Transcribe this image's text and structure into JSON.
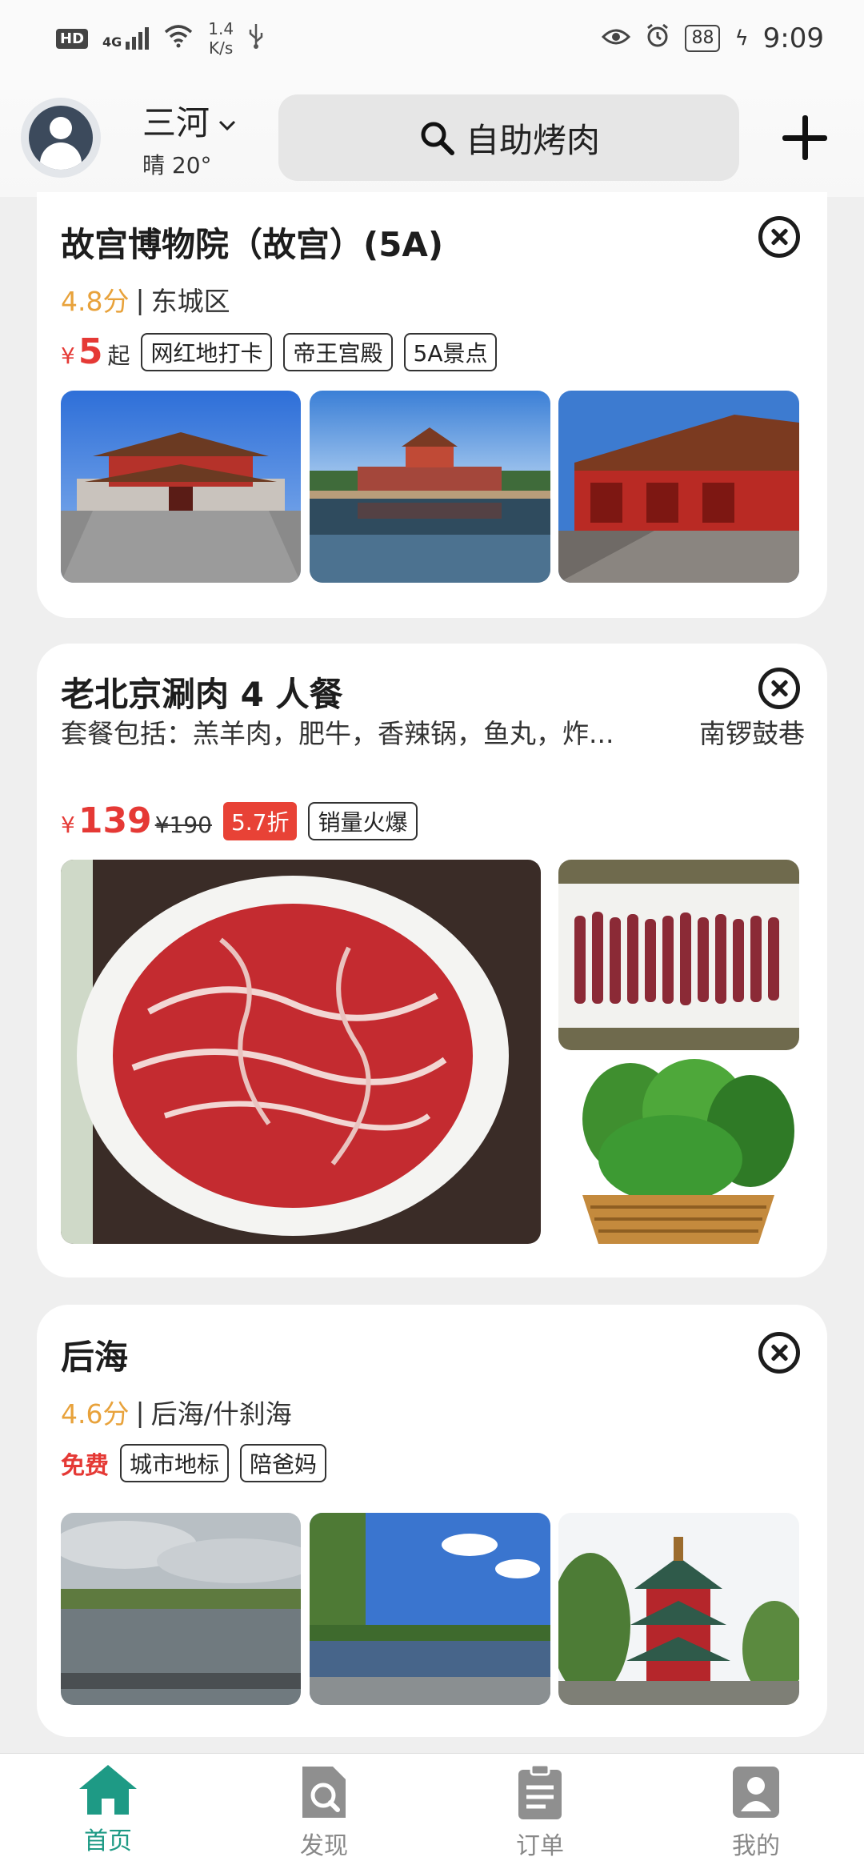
{
  "status_bar": {
    "hd": "HD",
    "network": "4G",
    "net_speed_value": "1.4",
    "net_speed_unit": "K/s",
    "battery": "88",
    "time": "9:09"
  },
  "header": {
    "city": "三河",
    "weather": "晴 20°",
    "search_text": "自助烤肉"
  },
  "cards": [
    {
      "title": "故宫博物院（故宫）(5A)",
      "score": "4.8分",
      "district": "东城区",
      "price_prefix": "¥",
      "price": "5",
      "price_suffix": "起",
      "tags": [
        "网红地打卡",
        "帝王宫殿",
        "5A景点"
      ]
    },
    {
      "title": "老北京涮肉 4 人餐",
      "description": "套餐包括：羔羊肉，肥牛，香辣锅，鱼丸，炸...",
      "location": "南锣鼓巷",
      "price_prefix": "¥",
      "price": "139",
      "original_price": "¥190",
      "discount": "5.7折",
      "tags": [
        "销量火爆"
      ]
    },
    {
      "title": "后海",
      "score": "4.6分",
      "district": "后海/什刹海",
      "free_label": "免费",
      "tags": [
        "城市地标",
        "陪爸妈"
      ]
    }
  ],
  "bottom_nav": [
    {
      "label": "首页",
      "icon": "home-icon",
      "active": true
    },
    {
      "label": "发现",
      "icon": "discover-icon",
      "active": false
    },
    {
      "label": "订单",
      "icon": "orders-icon",
      "active": false
    },
    {
      "label": "我的",
      "icon": "profile-icon",
      "active": false
    }
  ],
  "colors": {
    "accent": "#1e9a85",
    "price": "#e53935",
    "score": "#e8a23b",
    "background": "#efefef"
  }
}
